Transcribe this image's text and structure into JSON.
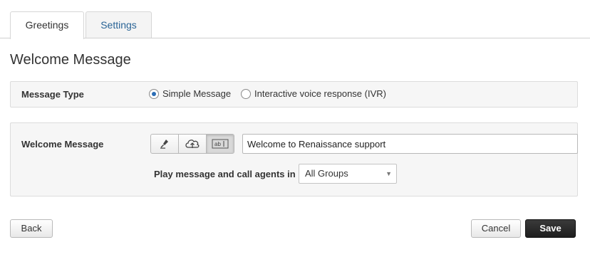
{
  "tabs": [
    {
      "label": "Greetings",
      "active": true
    },
    {
      "label": "Settings",
      "active": false
    }
  ],
  "page_title": "Welcome Message",
  "message_type": {
    "label": "Message Type",
    "options": [
      {
        "label": "Simple Message",
        "selected": true
      },
      {
        "label": "Interactive voice response (IVR)",
        "selected": false
      }
    ]
  },
  "welcome": {
    "label": "Welcome Message",
    "input_value": "Welcome to Renaissance support",
    "play_label": "Play message and call agents in",
    "group_select": "All Groups",
    "source_buttons": [
      "microphone-icon",
      "cloud-upload-icon",
      "text-field-icon"
    ]
  },
  "buttons": {
    "back": "Back",
    "cancel": "Cancel",
    "save": "Save"
  },
  "colors": {
    "link": "#2a6496",
    "radio_selected": "#2a6db5",
    "save_bg": "#2b2b2b"
  }
}
